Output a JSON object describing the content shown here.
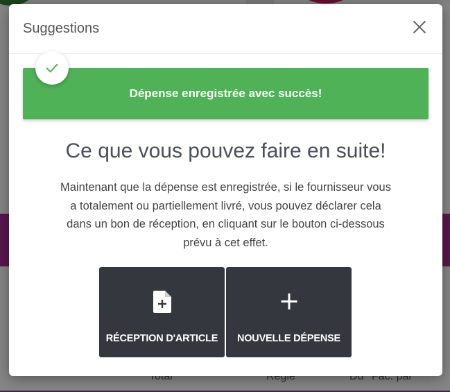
{
  "modal": {
    "title": "Suggestions",
    "close_icon": "close-icon"
  },
  "alert": {
    "message": "Dépense enregistrée avec succès!",
    "icon": "check-icon",
    "color": "#4fb257"
  },
  "content": {
    "heading": "Ce que vous pouvez faire en suite!",
    "description": "Maintenant que la dépense est enregistrée, si le fournisseur vous a totalement ou partiellement livré, vous pouvez déclarer cela dans un bon de réception, en cliquant sur le bouton ci-dessous prévu à cet effet."
  },
  "actions": [
    {
      "label": "RÉCEPTION D'ARTICLE",
      "icon": "file-add-icon"
    },
    {
      "label": "NOUVELLE DÉPENSE",
      "icon": "plus-icon"
    }
  ],
  "background": {
    "footer_labels": [
      "Total",
      "Réglé",
      "Du",
      "Fac. par"
    ]
  }
}
